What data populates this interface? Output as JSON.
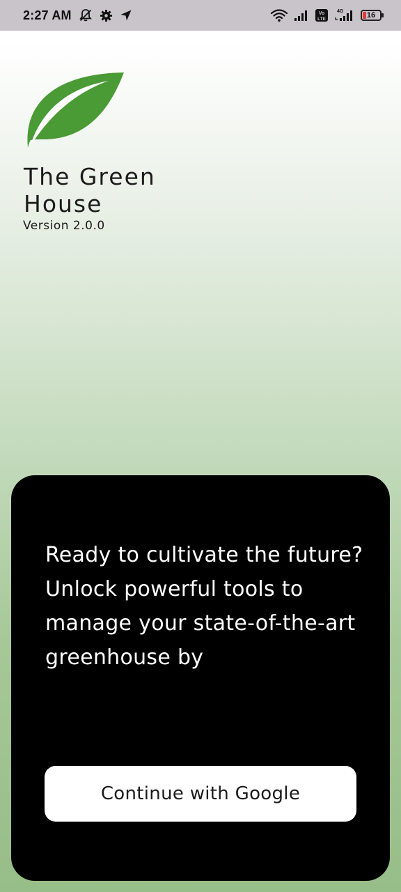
{
  "status_bar": {
    "time": "2:27 AM",
    "battery_level": "16",
    "network_label": "4G",
    "volte_label": "Vo LTE",
    "icons": [
      "notifications-off-icon",
      "settings-gear-icon",
      "location-arrow-icon",
      "wifi-icon",
      "signal-icon",
      "volte-icon",
      "signal-4g-icon",
      "battery-icon"
    ],
    "battery_color": "#e23a3a"
  },
  "app": {
    "logo_icon": "leaf-icon",
    "title": "The Green House",
    "version": "Version 2.0.0",
    "brand_color": "#4a9a35"
  },
  "card": {
    "message": "Ready to cultivate the future? Unlock powerful tools to manage your state-of-the-art greenhouse by",
    "button_label": "Continue with Google",
    "background": "#000000"
  }
}
